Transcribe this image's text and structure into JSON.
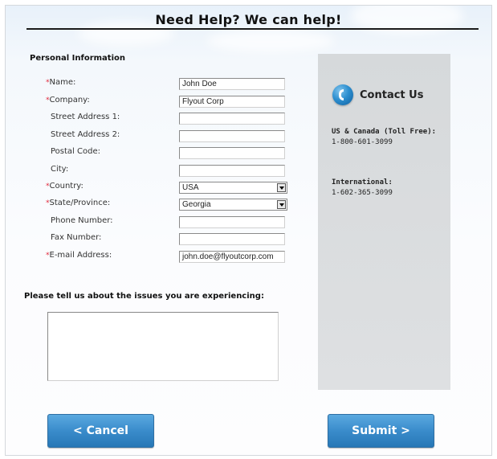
{
  "header": {
    "title": "Need Help? We can help!"
  },
  "personal": {
    "section_title": "Personal Information",
    "required_marker": "*",
    "fields": [
      {
        "label": "Name:",
        "required": true,
        "value": "John Doe"
      },
      {
        "label": "Company:",
        "required": true,
        "value": "Flyout Corp"
      },
      {
        "label": "Street Address 1:",
        "required": false,
        "value": ""
      },
      {
        "label": "Street Address 2:",
        "required": false,
        "value": ""
      },
      {
        "label": "Postal Code:",
        "required": false,
        "value": ""
      },
      {
        "label": "City:",
        "required": false,
        "value": ""
      },
      {
        "label": "Country:",
        "required": true,
        "value": "USA"
      },
      {
        "label": "State/Province:",
        "required": true,
        "value": "Georgia"
      },
      {
        "label": "Phone Number:",
        "required": false,
        "value": ""
      },
      {
        "label": "Fax Number:",
        "required": false,
        "value": ""
      },
      {
        "label": "E-mail Address:",
        "required": true,
        "value": "john.doe@flyoutcorp.com"
      }
    ]
  },
  "issues": {
    "label": "Please tell us about the issues you are experiencing:",
    "value": ""
  },
  "contact": {
    "title": "Contact Us",
    "icon": "phone-icon",
    "us_heading": "US & Canada (Toll Free):",
    "us_number": "1-800-601-3099",
    "intl_heading": "International:",
    "intl_number": "1-602-365-3099"
  },
  "buttons": {
    "cancel_label": "< Cancel",
    "submit_label": "Submit >"
  },
  "colors": {
    "required": "#e0263a",
    "button": "#3a8ccb",
    "panel": "#d9dcde"
  }
}
